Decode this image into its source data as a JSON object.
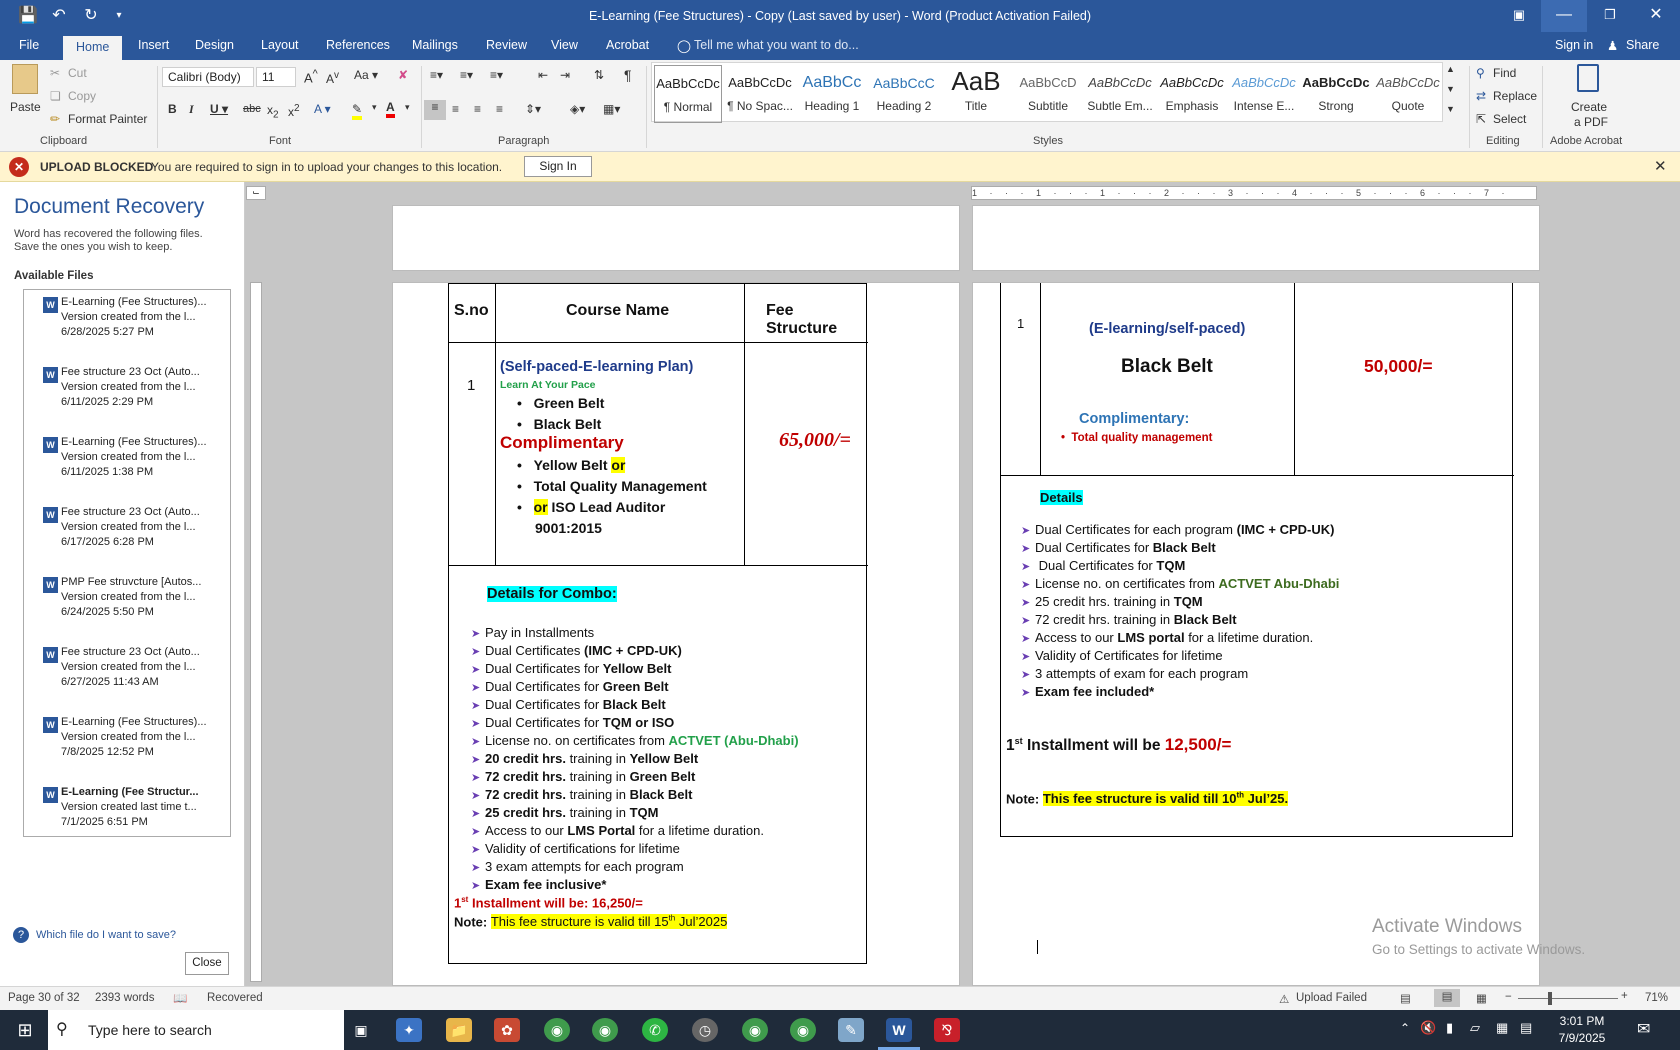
{
  "window": {
    "title": "E-Learning (Fee Structures) - Copy (Last saved by user) - Word (Product Activation Failed)"
  },
  "tabs": [
    "File",
    "Home",
    "Insert",
    "Design",
    "Layout",
    "References",
    "Mailings",
    "Review",
    "View",
    "Acrobat"
  ],
  "tell_me": "Tell me what you want to do...",
  "sign_in": "Sign in",
  "share": "Share",
  "clipboard": {
    "paste": "Paste",
    "cut": "Cut",
    "copy": "Copy",
    "format_painter": "Format Painter",
    "group": "Clipboard"
  },
  "font": {
    "name": "Calibri (Body)",
    "size": "11",
    "group": "Font"
  },
  "paragraph": {
    "group": "Paragraph"
  },
  "styles": {
    "group": "Styles",
    "items": [
      {
        "sample": "AaBbCcDc",
        "name": "¶ Normal"
      },
      {
        "sample": "AaBbCcDc",
        "name": "¶ No Spac..."
      },
      {
        "sample": "AaBbCc",
        "name": "Heading 1"
      },
      {
        "sample": "AaBbCcC",
        "name": "Heading 2"
      },
      {
        "sample": "AaB",
        "name": "Title"
      },
      {
        "sample": "AaBbCcD",
        "name": "Subtitle"
      },
      {
        "sample": "AaBbCcDc",
        "name": "Subtle Em..."
      },
      {
        "sample": "AaBbCcDc",
        "name": "Emphasis"
      },
      {
        "sample": "AaBbCcDc",
        "name": "Intense E..."
      },
      {
        "sample": "AaBbCcDc",
        "name": "Strong"
      },
      {
        "sample": "AaBbCcDc",
        "name": "Quote"
      }
    ]
  },
  "editing": {
    "find": "Find",
    "replace": "Replace",
    "select": "Select",
    "group": "Editing"
  },
  "acrobat": {
    "create": "Create",
    "create2": "a PDF",
    "group": "Adobe Acrobat"
  },
  "upload_bar": {
    "title": "UPLOAD BLOCKED",
    "message": "You are required to sign in to upload your changes to this location.",
    "button": "Sign In"
  },
  "recovery": {
    "title": "Document Recovery",
    "desc1": "Word has recovered the following files.",
    "desc2": "Save the ones you wish to keep.",
    "available": "Available Files",
    "files": [
      {
        "name": "E-Learning (Fee Structures)...",
        "info": "Version created from the l...",
        "date": "6/28/2025 5:27 PM"
      },
      {
        "name": "Fee structure 23 Oct (Auto...",
        "info": "Version created from the l...",
        "date": "6/11/2025 2:29 PM"
      },
      {
        "name": "E-Learning (Fee Structures)...",
        "info": "Version created from the l...",
        "date": "6/11/2025 1:38 PM"
      },
      {
        "name": "Fee structure 23 Oct (Auto...",
        "info": "Version created from the l...",
        "date": "6/17/2025 6:28 PM"
      },
      {
        "name": "PMP Fee struvcture  [Autos...",
        "info": "Version created from the l...",
        "date": "6/24/2025 5:50 PM"
      },
      {
        "name": "Fee structure 23 Oct (Auto...",
        "info": "Version created from the l...",
        "date": "6/27/2025 11:43 AM"
      },
      {
        "name": "E-Learning (Fee Structures)...",
        "info": "Version created from the l...",
        "date": "7/8/2025 12:52 PM"
      },
      {
        "name": "E-Learning (Fee Structur...",
        "info": "Version created last time t...",
        "date": "7/1/2025 6:51 PM"
      }
    ],
    "help": "Which file do I want to save?",
    "close": "Close"
  },
  "left_page": {
    "headers": [
      "S.no",
      "Course Name",
      "Fee Structure"
    ],
    "sno": "1",
    "plan": "(Self-paced-E-learning Plan)",
    "pace": "Learn At Your Pace",
    "belts": [
      "Green Belt",
      "Black Belt"
    ],
    "complimentary": "Complimentary",
    "comp_items": [
      "Yellow Belt",
      "or",
      "Total Quality Management",
      "or",
      "ISO Lead Auditor",
      "9001:2015"
    ],
    "fee": "65,000/=",
    "combo_title": "Details for Combo:",
    "details": [
      "Pay in Installments",
      "Dual Certificates",
      "(IMC + CPD-UK)",
      "Dual Certificates for",
      "Yellow Belt",
      "Green Belt",
      "Black Belt",
      "TQM or ISO",
      "License no. on certificates from",
      "ACTVET (Abu-Dhabi)",
      "20 credit hrs.",
      "72 credit hrs.",
      "25 credit hrs.",
      "training in",
      "TQM",
      "Access to our",
      "LMS Portal",
      "for a lifetime duration.",
      "Validity of certifications for lifetime",
      "3 exam attempts for each program",
      "Exam fee inclusive*"
    ],
    "installment": "Installment will be: 16,250/=",
    "note_label": "Note:",
    "note_a": "This fee structure is valid till 15",
    "note_b": "Jul’2025"
  },
  "right_page": {
    "sno": "1",
    "plan": "(E-learning/self-paced)",
    "course": "Black Belt",
    "complimentary": "Complimentary:",
    "comp_item": "Total quality management",
    "fee": "50,000/=",
    "details_title": "Details",
    "lines": {
      "l1a": "Dual Certificates for each program",
      "l1b": "(IMC + CPD-UK)",
      "l2a": "Dual Certificates for",
      "l2b": "Black Belt",
      "l3a": " Dual Certificates for",
      "l3b": "TQM",
      "l4a": "License no. on certificates from",
      "l4b": "ACTVET Abu-Dhabi",
      "l5a": "25 credit hrs. training in",
      "l5b": "TQM",
      "l6a": "72 credit hrs. training in",
      "l6b": "Black Belt",
      "l7a": "Access to our",
      "l7b": "LMS portal",
      "l7c": "for a lifetime duration.",
      "l8": "Validity of Certificates for lifetime",
      "l9": "3 attempts of exam for each program",
      "l10": "Exam fee included*"
    },
    "installment_a": "Installment will be",
    "installment_b": "12,500/=",
    "note_label": "Note:",
    "note_a": "This fee structure is valid till 10",
    "note_b": "Jul’25."
  },
  "watermark": {
    "l1": "Activate Windows",
    "l2": "Go to Settings to activate Windows."
  },
  "status": {
    "page": "Page 30 of 32",
    "words": "2393 words",
    "recovered": "Recovered",
    "upload": "Upload Failed",
    "zoom": "71%"
  },
  "taskbar": {
    "search": "Type here to search",
    "time": "3:01 PM",
    "date": "7/9/2025"
  }
}
